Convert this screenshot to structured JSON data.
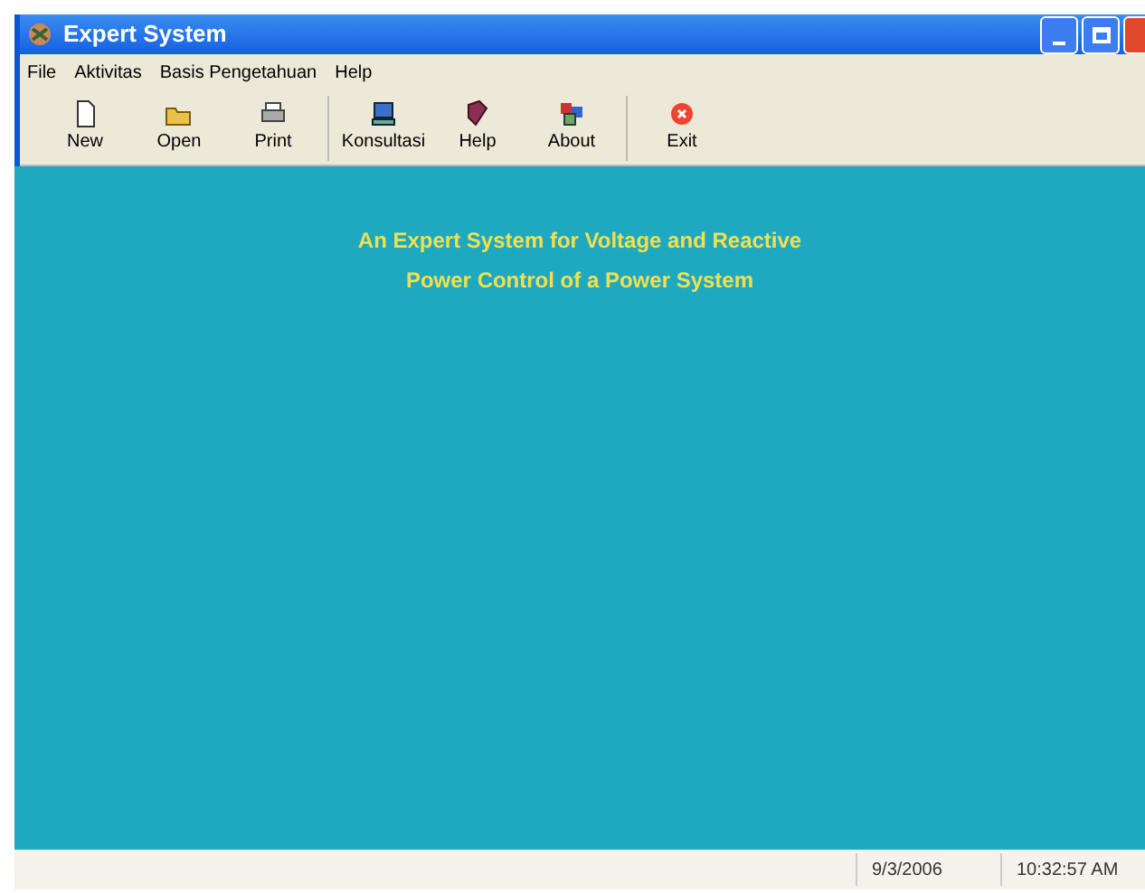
{
  "window": {
    "title": "Expert System"
  },
  "menu": [
    "File",
    "Aktivitas",
    "Basis Pengetahuan",
    "Help"
  ],
  "toolbar": [
    {
      "buttons": [
        {
          "label": "New",
          "kind": "new"
        },
        {
          "label": "Open",
          "kind": "open"
        },
        {
          "label": "Print",
          "kind": "print"
        }
      ]
    },
    {
      "buttons": [
        {
          "label": "Konsultasi",
          "kind": "consult"
        },
        {
          "label": "Help",
          "kind": "help"
        },
        {
          "label": "About",
          "kind": "about"
        }
      ]
    },
    {
      "buttons": [
        {
          "label": "Exit",
          "kind": "exit"
        }
      ]
    }
  ],
  "heading": [
    "An Expert System for Voltage and Reactive",
    "Power Control of a Power System"
  ],
  "status_bar": [
    "9/3/2006",
    "10:32:57 AM"
  ]
}
